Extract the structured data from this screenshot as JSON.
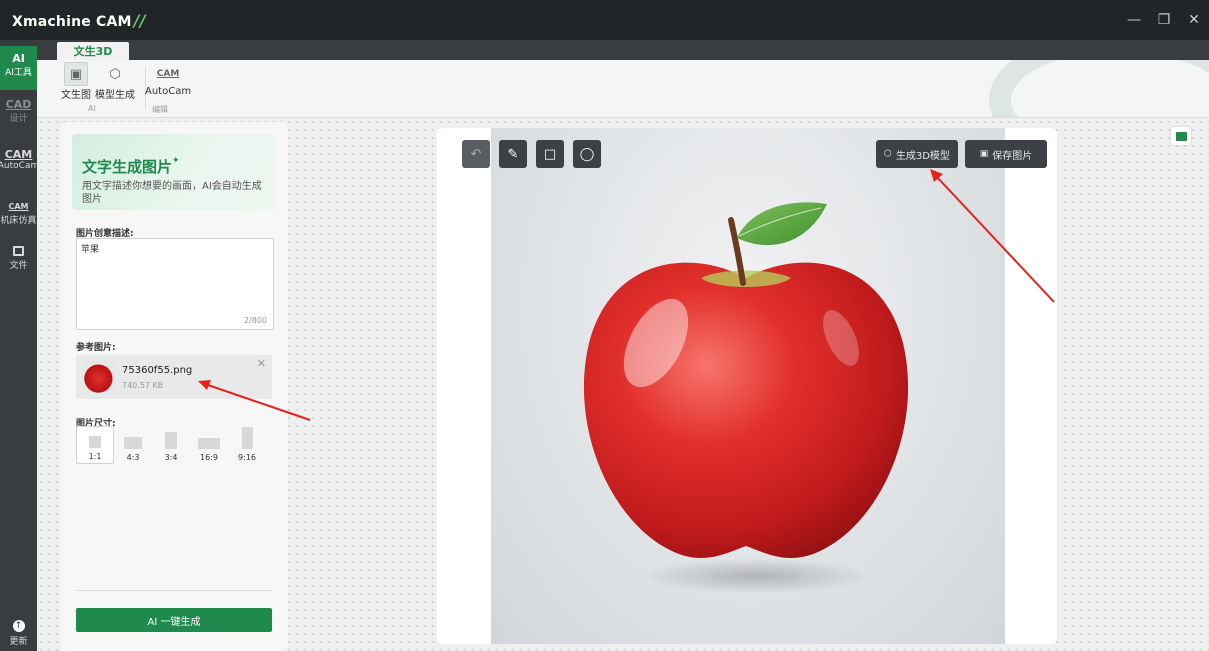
{
  "window": {
    "title": "Xmachine CAM",
    "controls": [
      "minimize",
      "restore",
      "close"
    ]
  },
  "rail": [
    {
      "label": "AI工具",
      "icon_text": "AI",
      "active": true
    },
    {
      "label": "设计",
      "icon_text": "CAD",
      "active": false,
      "dim": true
    },
    {
      "label": "AutoCam",
      "icon_text": "CAM",
      "active": false
    },
    {
      "label": "机床仿真",
      "icon_text": "CAM",
      "active": false
    },
    {
      "label": "文件",
      "icon_text": "",
      "active": false
    },
    {
      "label": "更新",
      "icon_text": "",
      "active": false
    }
  ],
  "ribbon": {
    "tab": "文生3D",
    "buttons": [
      {
        "label": "文生图",
        "active": true
      },
      {
        "label": "模型生成",
        "active": false
      },
      {
        "label": "AutoCam",
        "active": false,
        "icon_text": "CAM"
      }
    ],
    "groups": [
      "AI",
      "编辑"
    ]
  },
  "panel": {
    "title": "文字生成图片",
    "subtitle": "用文字描述你想要的画面，AI会自动生成图片",
    "prompt_label": "图片创意描述:",
    "prompt_value": "苹果",
    "prompt_counter": "2/800",
    "ref_label": "参考图片:",
    "ref_file": {
      "name": "75360f55.png",
      "size": "740.57 KB"
    },
    "size_label": "图片尺寸:",
    "ratios": [
      {
        "label": "1:1",
        "active": true
      },
      {
        "label": "4:3",
        "active": false
      },
      {
        "label": "3:4",
        "active": false
      },
      {
        "label": "16:9",
        "active": false
      },
      {
        "label": "9:16",
        "active": false
      }
    ],
    "generate_button": "AI 一键生成"
  },
  "image_toolbar": {
    "tools": [
      "undo",
      "draw",
      "rectangle",
      "circle"
    ],
    "generate_3d": "生成3D模型",
    "save_image": "保存图片"
  },
  "colors": {
    "accent": "#1f8a4c",
    "titlebar": "#222527",
    "rail": "#3a3d40",
    "annotation": "#e8201a"
  }
}
